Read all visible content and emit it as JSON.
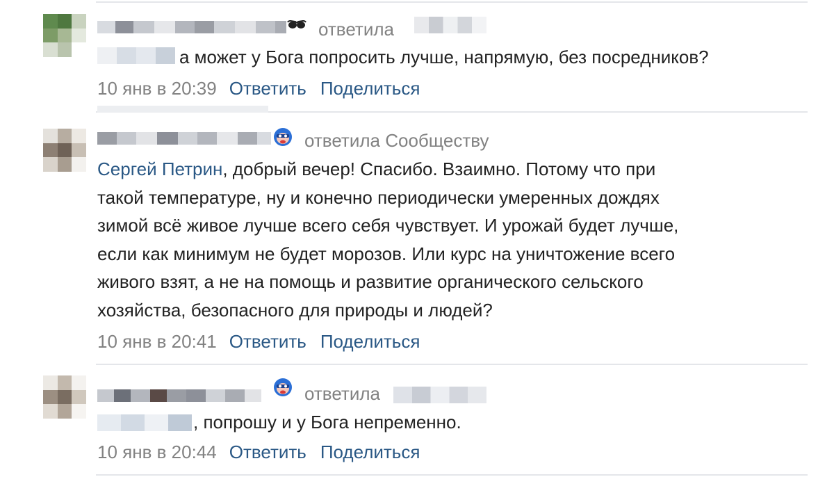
{
  "comments": [
    {
      "replied_label": "ответила",
      "reply_target": "",
      "reply_icon": "sunglasses-icon",
      "text": "а может у Бога попросить лучше, напрямую, без посредников?",
      "time": "10 янв в 20:39",
      "reply_action": "Ответить",
      "share_action": "Поделиться"
    },
    {
      "replied_label": "ответила",
      "reply_target": "Сообществу",
      "reply_icon": "community-avatar-icon",
      "mention": "Сергей Петрин",
      "text_lines": [
        ", добрый вечер! Спасибо. Взаимно. Потому что при",
        "такой температуре, ну и конечно периодически умеренных дождях",
        "зимой всё живое лучше всего себя чувствует. И урожай будет лучше,",
        "если как минимум не будет морозов. Или курс на уничтожение всего",
        "живого взят, а не на помощь и развитие органического сельского",
        "хозяйства, безопасного для природы и людей?"
      ],
      "time": "10 янв в 20:41",
      "reply_action": "Ответить",
      "share_action": "Поделиться"
    },
    {
      "replied_label": "ответила",
      "reply_target": "",
      "reply_icon": "community-avatar-icon",
      "text": ", попрошу и у Бога непременно.",
      "time": "10 янв в 20:44",
      "reply_action": "Ответить",
      "share_action": "Поделиться"
    }
  ],
  "colors": {
    "link": "#2a5885",
    "secondary": "#828282",
    "text": "#222222",
    "divider": "#e4e6ea"
  }
}
